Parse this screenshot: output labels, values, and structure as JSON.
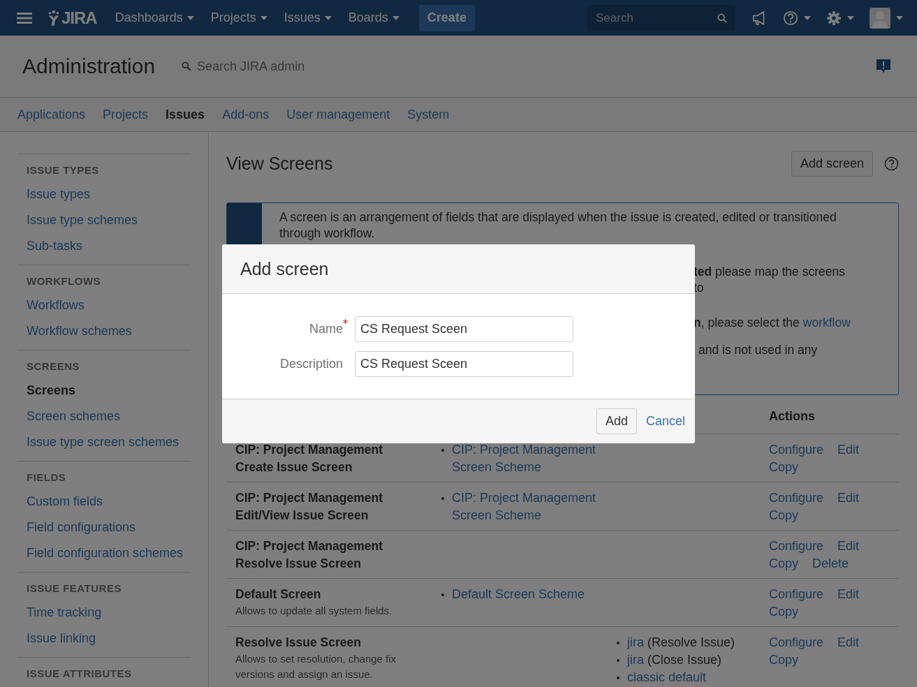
{
  "top_nav": {
    "logo": "JIRA",
    "menus": [
      {
        "label": "Dashboards"
      },
      {
        "label": "Projects"
      },
      {
        "label": "Issues"
      },
      {
        "label": "Boards"
      }
    ],
    "create_button": "Create",
    "search": {
      "placeholder": "Search"
    }
  },
  "admin_header": {
    "title": "Administration",
    "search": {
      "placeholder": "Search JIRA admin"
    }
  },
  "admin_tabs": [
    {
      "label": "Applications",
      "selected": false
    },
    {
      "label": "Projects",
      "selected": false
    },
    {
      "label": "Issues",
      "selected": true
    },
    {
      "label": "Add-ons",
      "selected": false
    },
    {
      "label": "User management",
      "selected": false
    },
    {
      "label": "System",
      "selected": false
    }
  ],
  "sidebar": {
    "sections": [
      {
        "heading": "ISSUE TYPES",
        "items": [
          {
            "label": "Issue types",
            "selected": false
          },
          {
            "label": "Issue type schemes",
            "selected": false
          },
          {
            "label": "Sub-tasks",
            "selected": false
          }
        ]
      },
      {
        "heading": "WORKFLOWS",
        "items": [
          {
            "label": "Workflows",
            "selected": false
          },
          {
            "label": "Workflow schemes",
            "selected": false
          }
        ]
      },
      {
        "heading": "SCREENS",
        "items": [
          {
            "label": "Screens",
            "selected": true
          },
          {
            "label": "Screen schemes",
            "selected": false
          },
          {
            "label": "Issue type screen schemes",
            "selected": false
          }
        ]
      },
      {
        "heading": "FIELDS",
        "items": [
          {
            "label": "Custom fields",
            "selected": false
          },
          {
            "label": "Field configurations",
            "selected": false
          },
          {
            "label": "Field configuration schemes",
            "selected": false
          }
        ]
      },
      {
        "heading": "ISSUE FEATURES",
        "items": [
          {
            "label": "Time tracking",
            "selected": false
          },
          {
            "label": "Issue linking",
            "selected": false
          }
        ]
      },
      {
        "heading": "ISSUE ATTRIBUTES"
      }
    ]
  },
  "page": {
    "title": "View Screens",
    "add_button": "Add screen"
  },
  "info_panel": {
    "paragraphs": [
      {
        "text": "A screen is an arrangement of fields that are displayed when the issue is created, edited or transitioned through workflow."
      },
      {
        "text": "**ted** please map the screens to"
      },
      {
        "text": "**n**, please select the",
        "link": "workflow"
      },
      {
        "text": "and is not used in any"
      }
    ]
  },
  "table": {
    "actions_header": "Actions",
    "rows": [
      {
        "name": "CIP: Project Management Create Issue Screen",
        "schemes": [
          "CIP: Project Management Screen Scheme"
        ],
        "actions": [
          "Configure",
          "Edit",
          "Copy"
        ]
      },
      {
        "name": "CIP: Project Management Edit/View Issue Screen",
        "schemes": [
          "CIP: Project Management Screen Scheme"
        ],
        "actions": [
          "Configure",
          "Edit",
          "Copy"
        ]
      },
      {
        "name": "CIP: Project Management Resolve Issue Screen",
        "actions": [
          "Configure",
          "Edit",
          "Copy",
          "Delete"
        ]
      },
      {
        "name": "Default Screen",
        "description": "Allows to update all system fields.",
        "schemes": [
          "Default Screen Scheme"
        ],
        "actions": [
          "Configure",
          "Edit",
          "Copy"
        ]
      },
      {
        "name": "Resolve Issue Screen",
        "description": "Allows to set resolution, change fix versions and assign an issue.",
        "workflows": [
          {
            "link": "jira",
            "note": "(Resolve Issue)"
          },
          {
            "link": "jira",
            "note": "(Close Issue)"
          },
          {
            "link": "classic default"
          }
        ],
        "actions": [
          "Configure",
          "Edit",
          "Copy"
        ]
      }
    ]
  },
  "dialog": {
    "title": "Add screen",
    "fields": [
      {
        "label": "Name",
        "required": true,
        "value": "CS Request Sceen"
      },
      {
        "label": "Description",
        "required": false,
        "value": "CS Request Sceen"
      }
    ],
    "submit": "Add",
    "cancel": "Cancel"
  }
}
